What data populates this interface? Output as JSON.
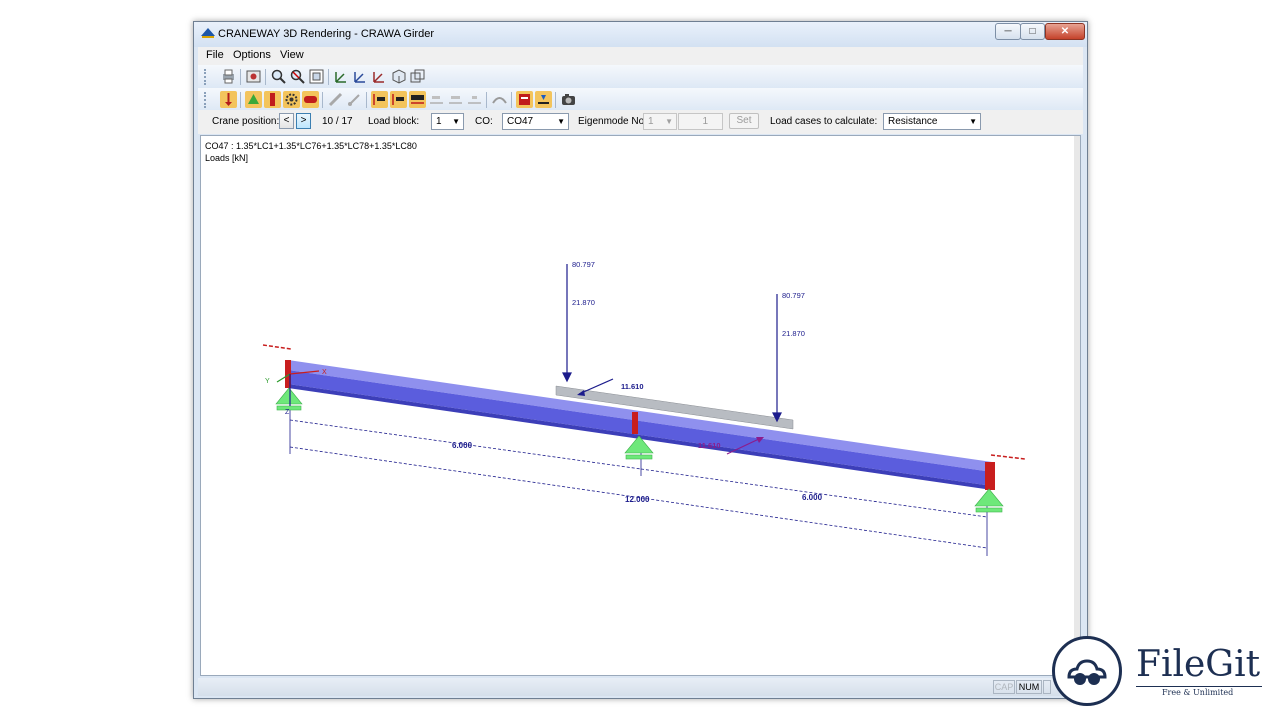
{
  "window": {
    "title": "CRANEWAY 3D Rendering - CRAWA Girder",
    "min_glyph": "─",
    "max_glyph": "□",
    "close_glyph": "✕"
  },
  "menu": {
    "items": [
      "File",
      "Options",
      "View"
    ]
  },
  "toolbars": {
    "row1_icons": [
      "print-icon",
      "settings-icon",
      "zoom-icon",
      "zoom-reset-icon",
      "fit-all-icon",
      "view-x-icon",
      "view-y-icon",
      "view-z-icon",
      "view-iso-icon",
      "view-3d-icon"
    ],
    "row2_icons": [
      "loads-icon",
      "support-icon",
      "member-icon",
      "gear-icon",
      "section-icon",
      "pencil-icon",
      "brush-icon",
      "result-1-icon",
      "result-2-icon",
      "result-3-icon",
      "result-4-icon",
      "result-5-icon",
      "result-6-icon",
      "deformation-icon",
      "values-icon",
      "legend-icon",
      "camera-icon"
    ]
  },
  "params": {
    "crane_position_label": "Crane position:",
    "crane_position_value": "10 / 17",
    "prev_glyph": "<",
    "next_glyph": ">",
    "load_block_label": "Load block:",
    "load_block_value": "1",
    "co_label": "CO:",
    "co_value": "CO47",
    "eigenmode_label": "Eigenmode No.",
    "eigenmode_value": "1",
    "eigenmode_spin_value": "1",
    "set_label": "Set",
    "load_cases_label": "Load cases to calculate:",
    "load_cases_value": "Resistance",
    "arrow_glyph": "▼"
  },
  "view": {
    "combination_text": "CO47 : 1.35*LC1+1.35*LC76+1.35*LC78+1.35*LC80",
    "loads_unit": "Loads [kN]",
    "axis_x": "X",
    "axis_y": "Y",
    "axis_z": "Z",
    "load_left_top": "80.797",
    "load_left_mid": "21.870",
    "load_right_top": "80.797",
    "load_right_mid": "21.870",
    "horiz_load_upper": "11.610",
    "horiz_load_lower": "11.610",
    "dim_span_1": "6.000",
    "dim_span_2": "6.000",
    "dim_total": "12.000",
    "beam_color": "#5b5ddd",
    "support_color": "#6ee87a",
    "load_color": "#1c1c8c",
    "horizontal_load_color": "#8c1c8c"
  },
  "status": {
    "cap": "CAP",
    "num": "NUM"
  },
  "watermark": {
    "brand": "FileGit",
    "tagline": "Free & Unlimited"
  }
}
